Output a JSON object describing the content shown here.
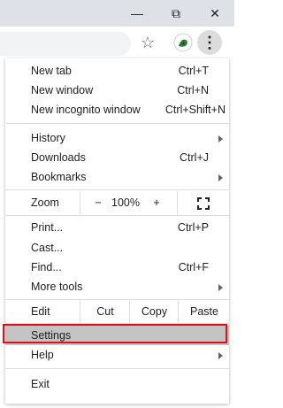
{
  "window": {
    "minimize_icon": "minimize-icon",
    "restore_icon": "restore-icon",
    "close_icon": "close-icon",
    "minimize_glyph": "—",
    "restore_glyph": "⧉",
    "close_glyph": "✕"
  },
  "toolbar": {
    "bookmark_glyph": "☆",
    "menu_glyph": "⋮"
  },
  "menu": {
    "new_tab": {
      "label": "New tab",
      "shortcut": "Ctrl+T"
    },
    "new_window": {
      "label": "New window",
      "shortcut": "Ctrl+N"
    },
    "new_incognito": {
      "label": "New incognito window",
      "shortcut": "Ctrl+Shift+N"
    },
    "history": {
      "label": "History"
    },
    "downloads": {
      "label": "Downloads",
      "shortcut": "Ctrl+J"
    },
    "bookmarks": {
      "label": "Bookmarks"
    },
    "zoom": {
      "label": "Zoom",
      "minus": "−",
      "value": "100%",
      "plus": "+"
    },
    "print": {
      "label": "Print...",
      "shortcut": "Ctrl+P"
    },
    "cast": {
      "label": "Cast..."
    },
    "find": {
      "label": "Find...",
      "shortcut": "Ctrl+F"
    },
    "more_tools": {
      "label": "More tools"
    },
    "edit": {
      "label": "Edit",
      "cut": "Cut",
      "copy": "Copy",
      "paste": "Paste"
    },
    "settings": {
      "label": "Settings"
    },
    "help": {
      "label": "Help"
    },
    "exit": {
      "label": "Exit"
    }
  },
  "colors": {
    "highlight_border": "#e0101a",
    "selected_bg": "#c3c3c3",
    "titlebar_bg": "#dee1e6"
  }
}
